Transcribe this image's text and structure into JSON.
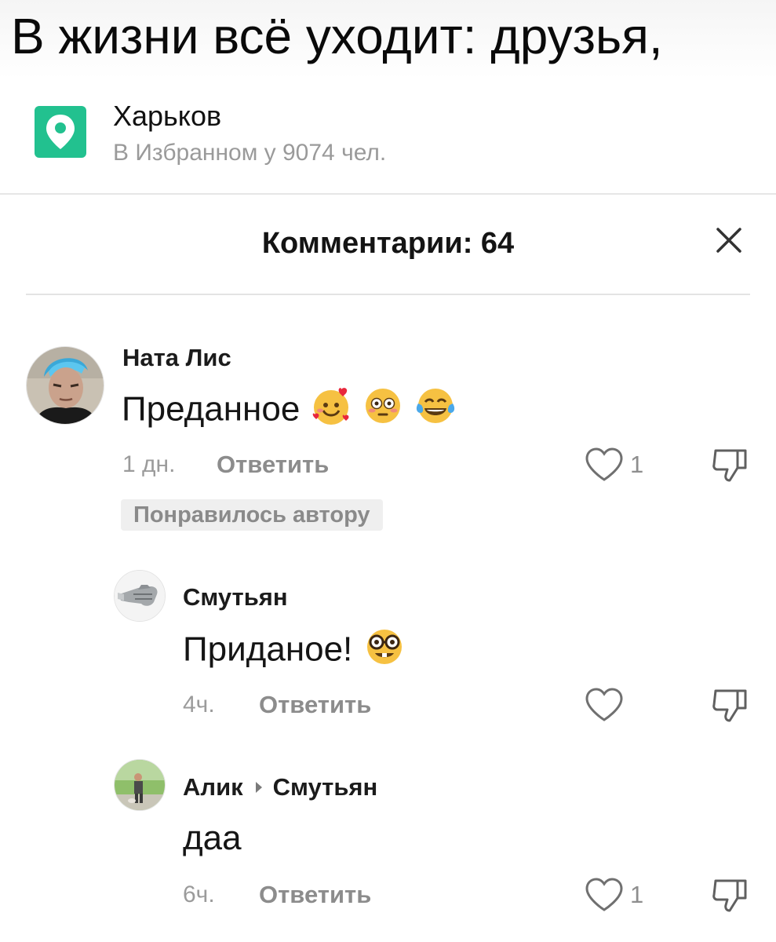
{
  "headline": {
    "text": "В жизни всё уходит: друзья,"
  },
  "location": {
    "icon": "map-pin-icon",
    "accent_color": "#22c18f",
    "title": "Харьков",
    "subtitle": "В Избранном у 9074 чел."
  },
  "comments_header": {
    "title": "Комментарии: 64",
    "close_icon": "close-icon"
  },
  "comments": [
    {
      "author": "Ната Лис",
      "text": "Преданное",
      "emojis": [
        "smiling-face-with-hearts",
        "flushed-face",
        "face-with-tears-of-joy"
      ],
      "time": "1 дн.",
      "reply_label": "Ответить",
      "likes": "1",
      "badge": "Понравилось автору"
    },
    {
      "author": "Смутьян",
      "text": "Приданое!",
      "emojis": [
        "nerd-face"
      ],
      "time": "4ч.",
      "reply_label": "Ответить",
      "likes": ""
    },
    {
      "author": "Алик",
      "reply_to": "Смутьян",
      "text": "даа",
      "emojis": [],
      "time": "6ч.",
      "reply_label": "Ответить",
      "likes": "1"
    }
  ]
}
